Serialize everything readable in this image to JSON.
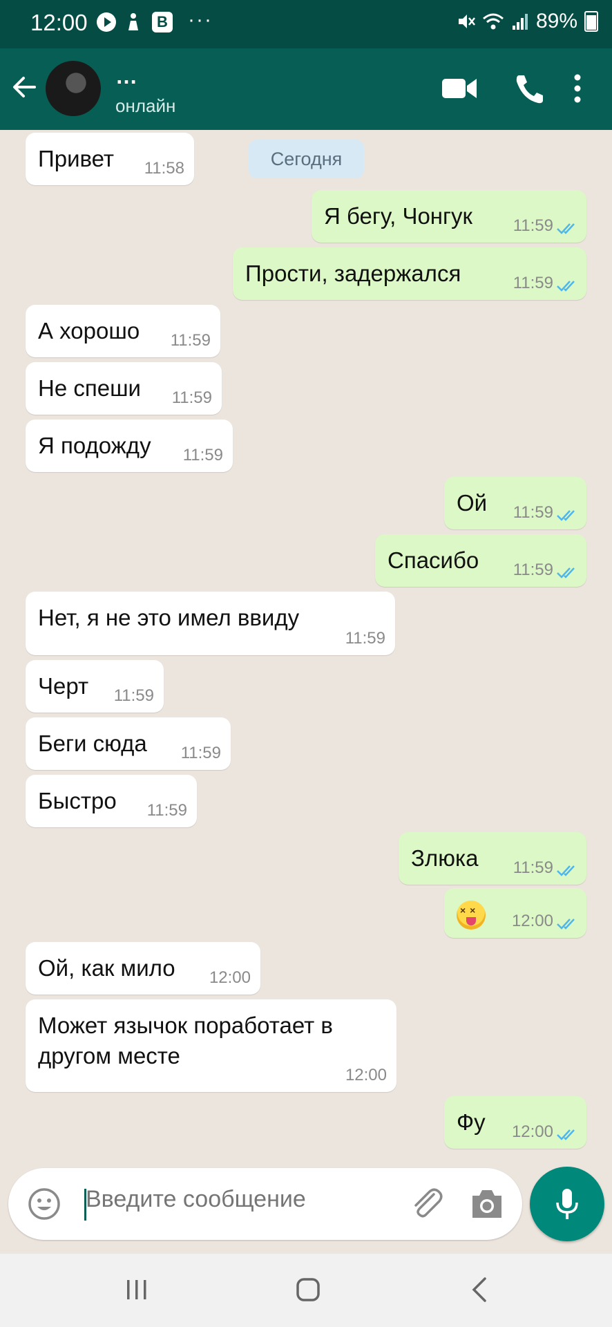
{
  "status_bar": {
    "time": "12:00",
    "dots": "···",
    "battery": "89%",
    "app_badge": "B"
  },
  "header": {
    "name": "…",
    "status": "онлайн"
  },
  "date_chip": "Сегодня",
  "messages": [
    {
      "dir": "in",
      "text": "Привет",
      "time": "11:58"
    },
    {
      "dir": "out",
      "text": "Я бегу, Чонгук",
      "time": "11:59"
    },
    {
      "dir": "out",
      "text": "Прости, задержался",
      "time": "11:59"
    },
    {
      "dir": "in",
      "text": "А хорошо",
      "time": "11:59"
    },
    {
      "dir": "in",
      "text": "Не спеши",
      "time": "11:59"
    },
    {
      "dir": "in",
      "text": "Я подожду",
      "time": "11:59"
    },
    {
      "dir": "out",
      "text": "Ой",
      "time": "11:59"
    },
    {
      "dir": "out",
      "text": "Спасибо",
      "time": "11:59"
    },
    {
      "dir": "in",
      "text": "Нет, я не это имел ввиду",
      "time": "11:59"
    },
    {
      "dir": "in",
      "text": "Черт",
      "time": "11:59"
    },
    {
      "dir": "in",
      "text": "Беги сюда",
      "time": "11:59"
    },
    {
      "dir": "in",
      "text": "Быстро",
      "time": "11:59"
    },
    {
      "dir": "out",
      "text": "Злюка",
      "time": "11:59"
    },
    {
      "dir": "out",
      "text": "",
      "emoji": "squinting-face-with-tongue",
      "time": "12:00"
    },
    {
      "dir": "in",
      "text": "Ой, как мило",
      "time": "12:00"
    },
    {
      "dir": "in",
      "text": "Может язычок поработает в\nдругом месте",
      "time": "12:00"
    },
    {
      "dir": "out",
      "text": "Фу",
      "time": "12:00"
    }
  ],
  "input": {
    "placeholder": "Введите сообщение"
  },
  "colors": {
    "header": "#075e54",
    "statusbar": "#054d44",
    "out_bubble": "#dcf8c6",
    "in_bubble": "#ffffff",
    "ticks": "#4fb6ec",
    "mic": "#00897b"
  }
}
